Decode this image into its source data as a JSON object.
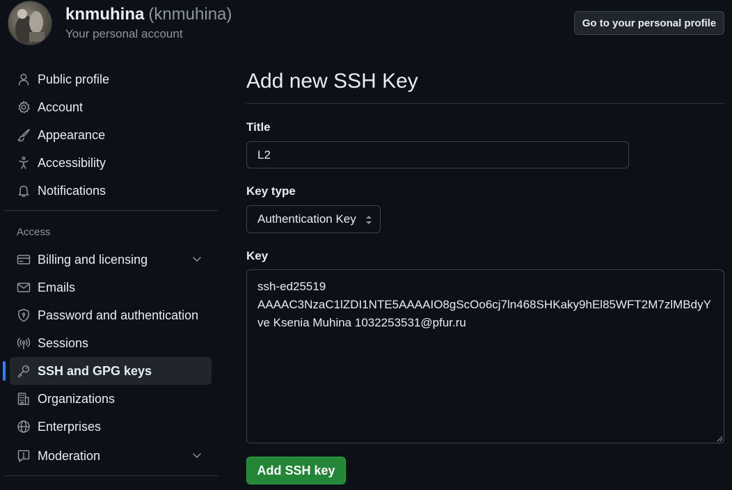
{
  "header": {
    "display_name": "knmuhina",
    "handle": "(knmuhina)",
    "subtitle": "Your personal account",
    "profile_button": "Go to your personal profile"
  },
  "sidebar": {
    "items": [
      {
        "label": "Public profile",
        "icon": "person-icon"
      },
      {
        "label": "Account",
        "icon": "gear-icon"
      },
      {
        "label": "Appearance",
        "icon": "paintbrush-icon"
      },
      {
        "label": "Accessibility",
        "icon": "accessibility-icon"
      },
      {
        "label": "Notifications",
        "icon": "bell-icon"
      }
    ],
    "access_heading": "Access",
    "access_items": [
      {
        "label": "Billing and licensing",
        "icon": "credit-card-icon",
        "expandable": true
      },
      {
        "label": "Emails",
        "icon": "mail-icon"
      },
      {
        "label": "Password and authentication",
        "icon": "shield-lock-icon"
      },
      {
        "label": "Sessions",
        "icon": "broadcast-icon"
      },
      {
        "label": "SSH and GPG keys",
        "icon": "key-icon",
        "active": true
      },
      {
        "label": "Organizations",
        "icon": "organization-icon"
      },
      {
        "label": "Enterprises",
        "icon": "globe-icon"
      },
      {
        "label": "Moderation",
        "icon": "report-icon",
        "expandable": true
      }
    ]
  },
  "main": {
    "title": "Add new SSH Key",
    "title_field": {
      "label": "Title",
      "value": "L2"
    },
    "key_type": {
      "label": "Key type",
      "selected": "Authentication Key"
    },
    "key_field": {
      "label": "Key",
      "value": "ssh-ed25519\nAAAAC3NzaC1lZDI1NTE5AAAAIO8gScOo6cj7ln468SHKaky9hEl85WFT2M7zlMBdyYve Ksenia Muhina 1032253531@pfur.ru"
    },
    "submit_label": "Add SSH key"
  },
  "colors": {
    "background": "#0d1117",
    "accent": "#2f81f7",
    "primary_button": "#238636"
  }
}
